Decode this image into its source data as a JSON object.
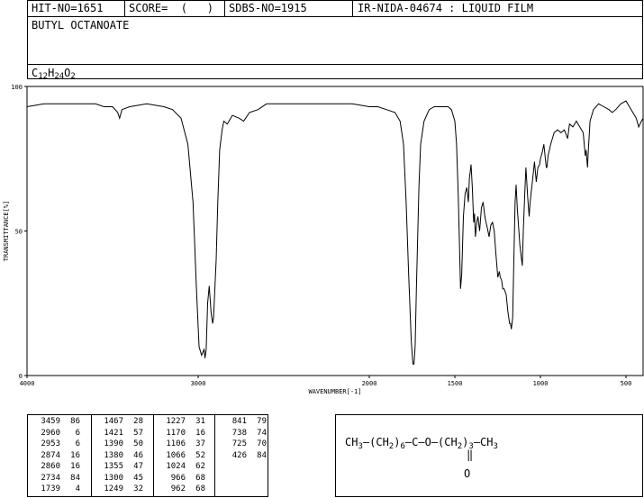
{
  "header": {
    "hit_no": "HIT-NO=1651",
    "score": "SCORE=  (   )",
    "sdbs_no": "SDBS-NO=1915",
    "ir_info": "IR-NIDA-04674 : LIQUID FILM",
    "compound": "BUTYL OCTANOATE",
    "formula": {
      "c": "C",
      "c_n": "12",
      "h": "H",
      "h_n": "24",
      "o": "O",
      "o_n": "2"
    }
  },
  "chart_data": {
    "type": "line",
    "xlabel": "WAVENUMBER[-1]",
    "ylabel": "TRANSMITTANCE[%]",
    "xlim": [
      4000,
      400
    ],
    "ylim": [
      0,
      100
    ],
    "xticks": [
      4000,
      3000,
      2000,
      1500,
      1000,
      500
    ],
    "yticks": [
      0,
      50,
      100
    ],
    "grid": false,
    "series": [
      {
        "points": [
          [
            4000,
            93
          ],
          [
            3900,
            94
          ],
          [
            3800,
            94
          ],
          [
            3700,
            94
          ],
          [
            3600,
            94
          ],
          [
            3550,
            93
          ],
          [
            3500,
            93
          ],
          [
            3470,
            91
          ],
          [
            3459,
            89
          ],
          [
            3445,
            92
          ],
          [
            3400,
            93
          ],
          [
            3300,
            94
          ],
          [
            3200,
            93
          ],
          [
            3150,
            92
          ],
          [
            3100,
            89
          ],
          [
            3060,
            80
          ],
          [
            3030,
            60
          ],
          [
            3010,
            30
          ],
          [
            2995,
            10
          ],
          [
            2980,
            7
          ],
          [
            2965,
            9
          ],
          [
            2960,
            6
          ],
          [
            2953,
            9
          ],
          [
            2945,
            25
          ],
          [
            2935,
            31
          ],
          [
            2925,
            22
          ],
          [
            2915,
            18
          ],
          [
            2910,
            20
          ],
          [
            2895,
            40
          ],
          [
            2885,
            60
          ],
          [
            2874,
            78
          ],
          [
            2860,
            85
          ],
          [
            2850,
            88
          ],
          [
            2830,
            87
          ],
          [
            2800,
            90
          ],
          [
            2760,
            89
          ],
          [
            2734,
            88
          ],
          [
            2700,
            91
          ],
          [
            2650,
            92
          ],
          [
            2600,
            94
          ],
          [
            2500,
            94
          ],
          [
            2400,
            94
          ],
          [
            2300,
            94
          ],
          [
            2200,
            94
          ],
          [
            2100,
            94
          ],
          [
            2000,
            93
          ],
          [
            1950,
            93
          ],
          [
            1900,
            92
          ],
          [
            1850,
            91
          ],
          [
            1820,
            88
          ],
          [
            1800,
            80
          ],
          [
            1785,
            60
          ],
          [
            1770,
            35
          ],
          [
            1755,
            12
          ],
          [
            1745,
            4
          ],
          [
            1739,
            4
          ],
          [
            1732,
            10
          ],
          [
            1725,
            30
          ],
          [
            1710,
            65
          ],
          [
            1700,
            80
          ],
          [
            1680,
            88
          ],
          [
            1650,
            92
          ],
          [
            1620,
            93
          ],
          [
            1580,
            93
          ],
          [
            1540,
            93
          ],
          [
            1520,
            92
          ],
          [
            1500,
            88
          ],
          [
            1490,
            80
          ],
          [
            1480,
            62
          ],
          [
            1470,
            38
          ],
          [
            1467,
            30
          ],
          [
            1460,
            35
          ],
          [
            1450,
            55
          ],
          [
            1440,
            63
          ],
          [
            1430,
            65
          ],
          [
            1421,
            60
          ],
          [
            1415,
            68
          ],
          [
            1405,
            73
          ],
          [
            1398,
            65
          ],
          [
            1390,
            53
          ],
          [
            1385,
            56
          ],
          [
            1380,
            48
          ],
          [
            1372,
            53
          ],
          [
            1365,
            55
          ],
          [
            1355,
            50
          ],
          [
            1345,
            58
          ],
          [
            1335,
            60
          ],
          [
            1325,
            55
          ],
          [
            1318,
            53
          ],
          [
            1310,
            51
          ],
          [
            1300,
            48
          ],
          [
            1290,
            52
          ],
          [
            1280,
            53
          ],
          [
            1270,
            50
          ],
          [
            1260,
            42
          ],
          [
            1249,
            34
          ],
          [
            1240,
            36
          ],
          [
            1235,
            34
          ],
          [
            1227,
            33
          ],
          [
            1220,
            30
          ],
          [
            1212,
            30
          ],
          [
            1200,
            28
          ],
          [
            1190,
            22
          ],
          [
            1180,
            18
          ],
          [
            1175,
            18
          ],
          [
            1170,
            16
          ],
          [
            1162,
            20
          ],
          [
            1155,
            40
          ],
          [
            1148,
            60
          ],
          [
            1142,
            66
          ],
          [
            1135,
            58
          ],
          [
            1120,
            45
          ],
          [
            1110,
            40
          ],
          [
            1106,
            38
          ],
          [
            1100,
            50
          ],
          [
            1090,
            65
          ],
          [
            1085,
            72
          ],
          [
            1075,
            62
          ],
          [
            1066,
            55
          ],
          [
            1060,
            60
          ],
          [
            1045,
            68
          ],
          [
            1035,
            74
          ],
          [
            1024,
            67
          ],
          [
            1015,
            72
          ],
          [
            1005,
            73
          ],
          [
            1000,
            75
          ],
          [
            990,
            77
          ],
          [
            980,
            80
          ],
          [
            966,
            72
          ],
          [
            962,
            72
          ],
          [
            955,
            76
          ],
          [
            940,
            80
          ],
          [
            920,
            84
          ],
          [
            900,
            85
          ],
          [
            880,
            84
          ],
          [
            860,
            85
          ],
          [
            841,
            82
          ],
          [
            830,
            87
          ],
          [
            810,
            86
          ],
          [
            790,
            88
          ],
          [
            770,
            86
          ],
          [
            750,
            84
          ],
          [
            738,
            76
          ],
          [
            733,
            78
          ],
          [
            725,
            72
          ],
          [
            720,
            78
          ],
          [
            710,
            88
          ],
          [
            690,
            92
          ],
          [
            660,
            94
          ],
          [
            630,
            93
          ],
          [
            600,
            92
          ],
          [
            580,
            91
          ],
          [
            560,
            92
          ],
          [
            530,
            94
          ],
          [
            500,
            95
          ],
          [
            480,
            93
          ],
          [
            460,
            91
          ],
          [
            440,
            89
          ],
          [
            426,
            86
          ],
          [
            410,
            88
          ],
          [
            400,
            89
          ]
        ]
      }
    ]
  },
  "peaks": [
    [
      [
        "3459",
        "86"
      ],
      [
        "2960",
        "6"
      ],
      [
        "2953",
        "6"
      ],
      [
        "2874",
        "16"
      ],
      [
        "2860",
        "16"
      ],
      [
        "2734",
        "84"
      ],
      [
        "1739",
        "4"
      ]
    ],
    [
      [
        "1467",
        "28"
      ],
      [
        "1421",
        "57"
      ],
      [
        "1390",
        "50"
      ],
      [
        "1380",
        "46"
      ],
      [
        "1355",
        "47"
      ],
      [
        "1300",
        "45"
      ],
      [
        "1249",
        "32"
      ]
    ],
    [
      [
        "1227",
        "31"
      ],
      [
        "1170",
        "16"
      ],
      [
        "1106",
        "37"
      ],
      [
        "1066",
        "52"
      ],
      [
        "1024",
        "62"
      ],
      [
        "966",
        "68"
      ],
      [
        "962",
        "68"
      ]
    ],
    [
      [
        "841",
        "79"
      ],
      [
        "738",
        "74"
      ],
      [
        "725",
        "70"
      ],
      [
        "426",
        "84"
      ]
    ]
  ],
  "structure": {
    "line": "CH3—(CH2)6—C—O—(CH2)3—CH3",
    "ch": "CH",
    "ch2": "CH",
    "sub3": "3",
    "sub2": "2",
    "sub6": "6",
    "dash": "—",
    "open": "(",
    "close": ")",
    "c": "C",
    "o": "O",
    "dbl": "‖"
  }
}
